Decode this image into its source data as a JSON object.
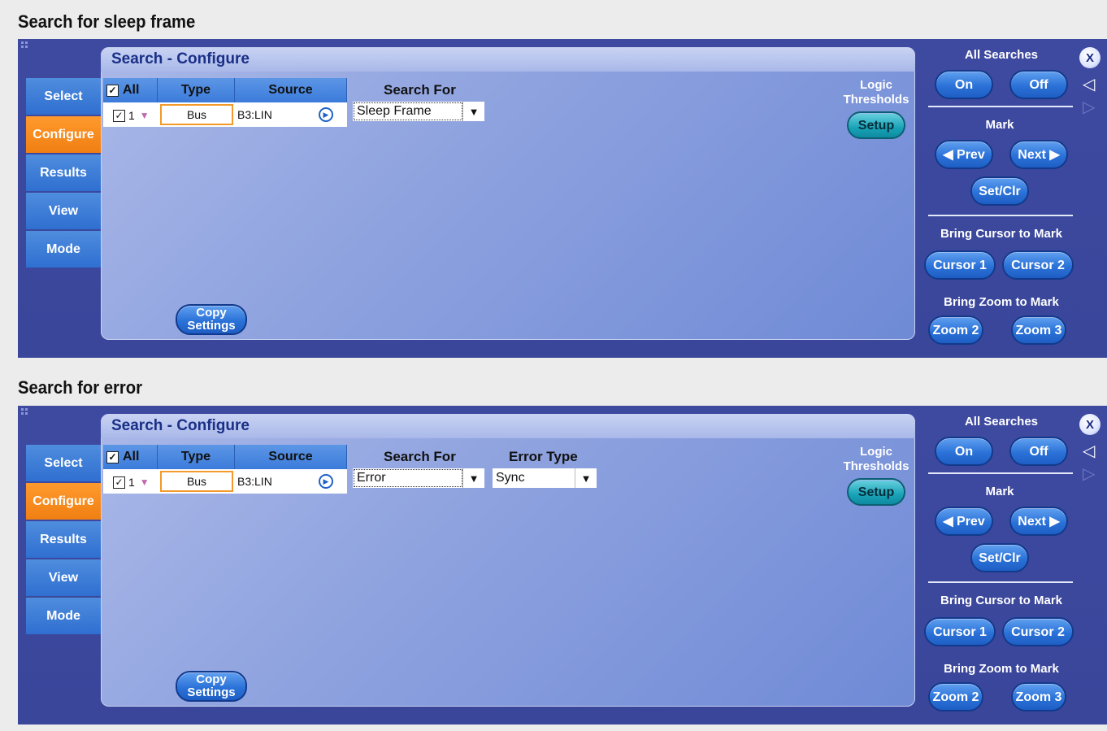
{
  "panels": [
    {
      "caption": "Search for sleep frame",
      "title": "Search - Configure",
      "tabs": [
        "Select",
        "Configure",
        "Results",
        "View",
        "Mode"
      ],
      "table": {
        "headers": {
          "all": "All",
          "type": "Type",
          "source": "Source"
        },
        "row": {
          "index": "1",
          "type": "Bus",
          "source": "B3:LIN"
        }
      },
      "search_for": {
        "label": "Search For",
        "value": "Sleep Frame"
      },
      "error_type": null,
      "copy_settings": "Copy Settings",
      "logic_thresholds": {
        "label": "Logic Thresholds",
        "button": "Setup"
      },
      "side": {
        "all_searches": "All Searches",
        "on": "On",
        "off": "Off",
        "mark": "Mark",
        "prev": "◀ Prev",
        "next": "Next ▶",
        "setclr": "Set/Clr",
        "bring_cursor": "Bring Cursor to Mark",
        "cursor1": "Cursor 1",
        "cursor2": "Cursor 2",
        "bring_zoom": "Bring Zoom to Mark",
        "zoom2": "Zoom 2",
        "zoom3": "Zoom 3",
        "close": "X"
      }
    },
    {
      "caption": "Search for error",
      "title": "Search - Configure",
      "tabs": [
        "Select",
        "Configure",
        "Results",
        "View",
        "Mode"
      ],
      "table": {
        "headers": {
          "all": "All",
          "type": "Type",
          "source": "Source"
        },
        "row": {
          "index": "1",
          "type": "Bus",
          "source": "B3:LIN"
        }
      },
      "search_for": {
        "label": "Search For",
        "value": "Error"
      },
      "error_type": {
        "label": "Error Type",
        "value": "Sync"
      },
      "copy_settings": "Copy Settings",
      "logic_thresholds": {
        "label": "Logic Thresholds",
        "button": "Setup"
      },
      "side": {
        "all_searches": "All Searches",
        "on": "On",
        "off": "Off",
        "mark": "Mark",
        "prev": "◀ Prev",
        "next": "Next ▶",
        "setclr": "Set/Clr",
        "bring_cursor": "Bring Cursor to Mark",
        "cursor1": "Cursor 1",
        "cursor2": "Cursor 2",
        "bring_zoom": "Bring Zoom to Mark",
        "zoom2": "Zoom 2",
        "zoom3": "Zoom 3",
        "close": "X"
      }
    }
  ],
  "colors": {
    "panel_bg": "#3e4aa0",
    "tab_blue": "#2f6fd0",
    "tab_active": "#f07f12",
    "button_blue": "#2b72d8",
    "button_teal": "#1aa3b8",
    "config_bg": "#8fa3df",
    "type_cell_border": "#f39a2a"
  },
  "icons": {
    "checkbox": "checked-checkbox-icon",
    "channel_marker": "triangle-down-icon",
    "source_arrow": "play-circle-icon",
    "dropdown_arrow": "triangle-down-icon",
    "nav_left": "triangle-left-icon",
    "nav_right": "triangle-right-icon"
  }
}
